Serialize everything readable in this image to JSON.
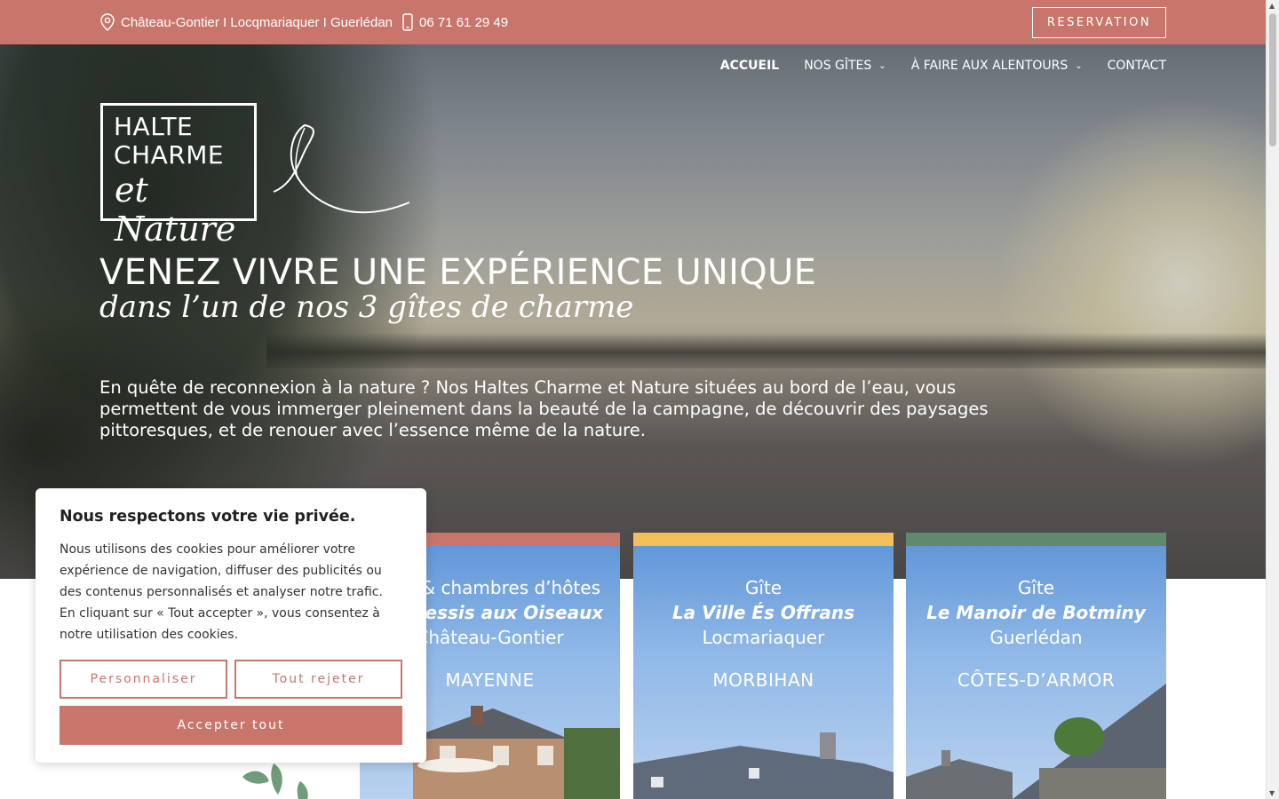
{
  "topbar": {
    "locations": "Château-Gontier I Locqmariaquer I Guerlédan",
    "phone": "06 71 61 29 49",
    "reservation": "RESERVATION"
  },
  "nav": {
    "items": [
      {
        "label": "ACCUEIL"
      },
      {
        "label": "NOS GÎTES"
      },
      {
        "label": "À FAIRE AUX ALENTOURS"
      },
      {
        "label": "CONTACT"
      }
    ]
  },
  "logo": {
    "line1": "HALTE",
    "line2": "CHARME",
    "line3": "et Nature"
  },
  "hero": {
    "headline": "VENEZ VIVRE UNE EXPÉRIENCE UNIQUE",
    "subline": "dans l’un de nos 3 gîtes de charme",
    "intro": "En quête de reconnexion à la nature ? Nos Haltes Charme et Nature situées au bord de l’eau, vous permettent de vous immerger pleinement dans la beauté de la campagne, de découvrir des paysages pittoresques, et de renouer avec l’essence même de la nature."
  },
  "cards": [
    {
      "kind": "Gîte & chambres d’hôtes",
      "name": "Le Plessis aux Oiseaux",
      "town": "Château-Gontier",
      "region": "MAYENNE",
      "accent": "#c8766c"
    },
    {
      "kind": "Gîte",
      "name": "La Ville És Offrans",
      "town": "Locmariaquer",
      "region": "MORBIHAN",
      "accent": "#f4bf5a"
    },
    {
      "kind": "Gîte",
      "name": "Le Manoir de Botminy",
      "town": "Guerlédan",
      "region": "CÔTES-D’ARMOR",
      "accent": "#5f8a6e"
    }
  ],
  "cookie": {
    "title": "Nous respectons votre vie privée.",
    "text": "Nous utilisons des cookies pour améliorer votre expérience de navigation, diffuser des publicités ou des contenus personnalisés et analyser notre trafic. En cliquant sur « Tout accepter », vous consentez à notre utilisation des cookies.",
    "customize": "Personnaliser",
    "reject": "Tout rejeter",
    "accept": "Accepter tout"
  },
  "colors": {
    "brand": "#c8766c",
    "accent_yellow": "#f4bf5a",
    "accent_green": "#5f8a6e"
  }
}
